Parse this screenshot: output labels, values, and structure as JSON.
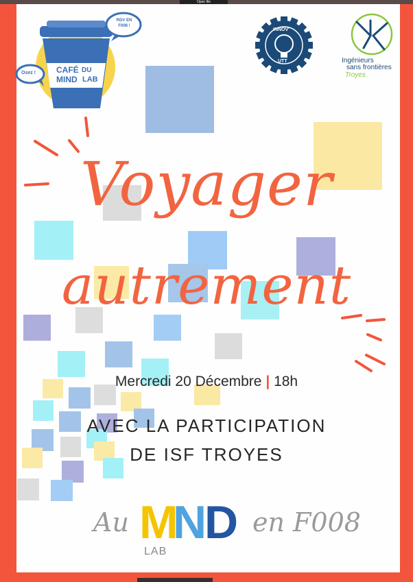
{
  "window": {
    "top_label": "Open file"
  },
  "title": {
    "line1": "Voyager",
    "line2": "autrement"
  },
  "event": {
    "date": "Mercredi 20 Décembre",
    "separator": "|",
    "time": "18h",
    "participation_line1": "AVEC LA PARTICIPATION",
    "participation_line2": "DE ISF TROYES"
  },
  "footer": {
    "au": "Au",
    "mnd_m": "M",
    "mnd_n": "N",
    "mnd_d": "D",
    "lab": "LAB",
    "en": "en F008"
  },
  "logos": {
    "cafe": {
      "line1": "CAFÉ",
      "line2": "DU",
      "line3": "MIND",
      "line4": "LAB",
      "bubble_left": "Osez !",
      "bubble_right": "RDV EN F008 !"
    },
    "innov": {
      "top": "INNOV'",
      "bottom": "UTT"
    },
    "isf": {
      "line1": "Ingénieurs",
      "line2": "sans frontières",
      "line3": "Troyes"
    }
  },
  "colors": {
    "border": "#f2553b",
    "title": "#f26440",
    "text": "#262626",
    "mnd_m": "#f5c400",
    "mnd_n": "#4fa3e0",
    "mnd_d": "#2355a0",
    "cafe_blue": "#3b6fb6",
    "cafe_yellow": "#f7d44c",
    "innov_navy": "#1b4a78",
    "isf_green": "#8cc63f"
  }
}
